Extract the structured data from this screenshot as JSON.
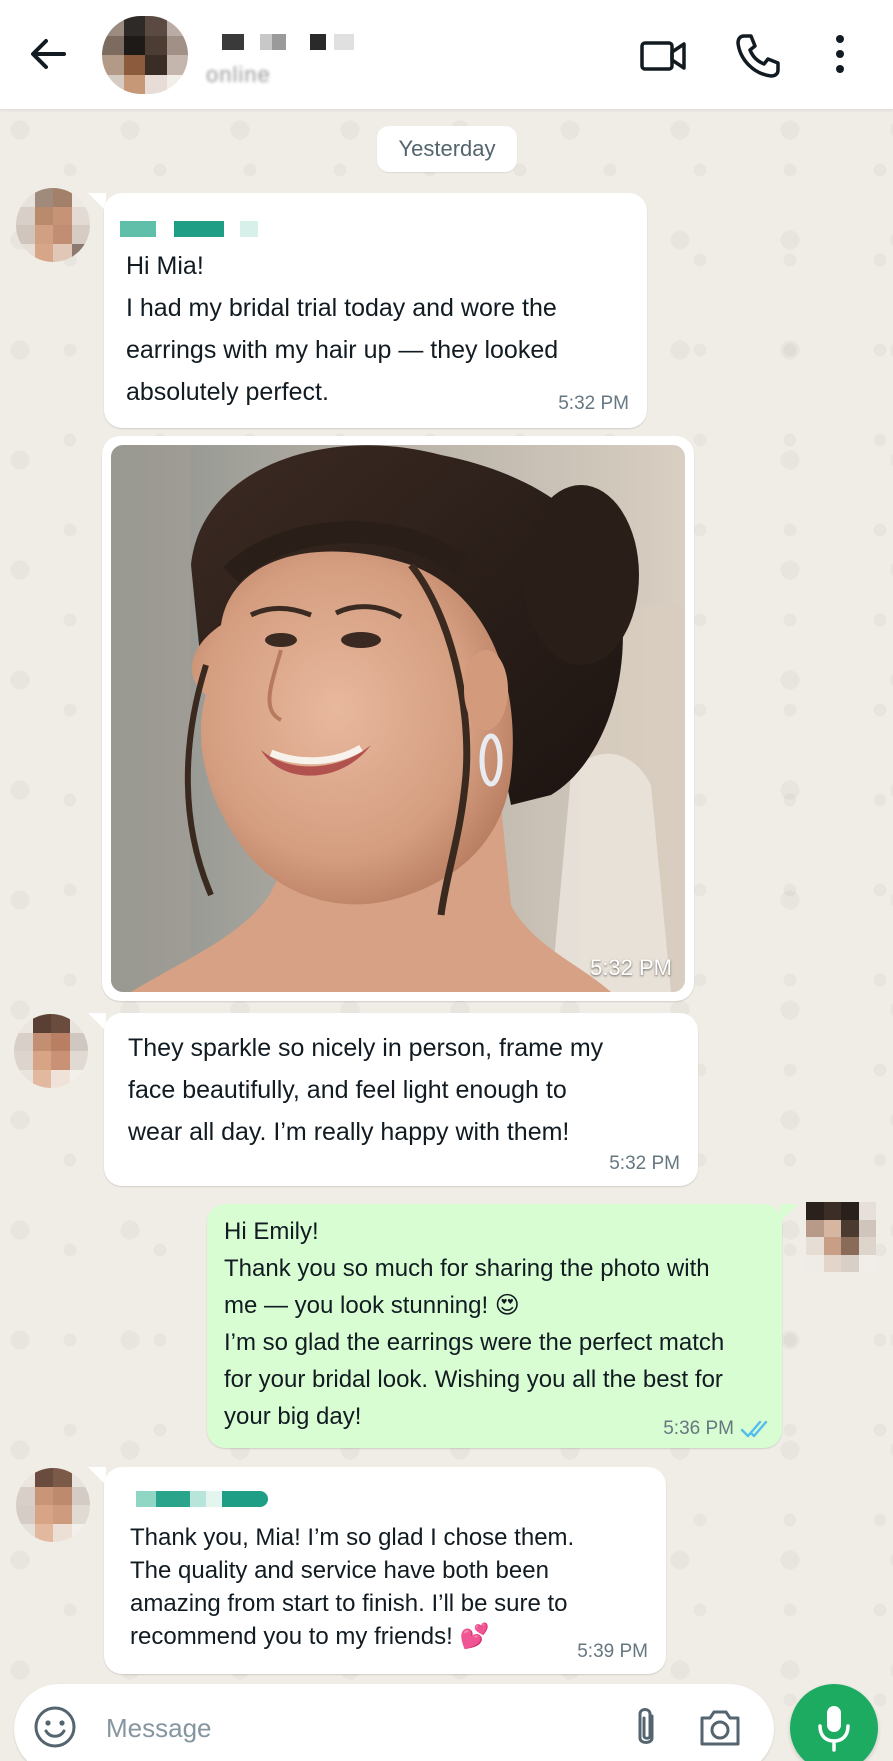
{
  "header": {
    "status": "online"
  },
  "date_chip": "Yesterday",
  "messages": [
    {
      "direction": "in",
      "lines": [
        "Hi Mia!",
        "I had my bridal trial today and wore the",
        "earrings with my hair up — they looked",
        "absolutely perfect."
      ],
      "time": "5:32 PM"
    },
    {
      "direction": "in",
      "type": "image",
      "time": "5:32 PM"
    },
    {
      "direction": "in",
      "lines": [
        "They sparkle so nicely in person, frame my",
        "face beautifully, and feel light enough to",
        "wear all day. I’m really happy with them!"
      ],
      "time": "5:32 PM"
    },
    {
      "direction": "out",
      "lines": [
        "Hi Emily!",
        "Thank you so much for sharing the photo with",
        "me — you look stunning! 😍",
        "I’m so glad the earrings were the perfect match",
        "for your bridal look. Wishing you all the best for",
        "your big day!"
      ],
      "time": "5:36 PM",
      "read_receipt": "double-check-blue"
    },
    {
      "direction": "in",
      "lines": [
        "Thank you, Mia! I’m so glad I chose them.",
        "The quality and service have both been",
        "amazing from start to finish. I’ll be sure to",
        "recommend you to my friends! 💕"
      ],
      "time": "5:39 PM"
    }
  ],
  "composer": {
    "placeholder": "Message"
  },
  "icons": {
    "back": "arrow-left-icon",
    "video": "video-camera-icon",
    "call": "phone-icon",
    "menu": "more-vertical-icon",
    "emoji": "smiley-icon",
    "attach": "paperclip-icon",
    "camera": "camera-icon",
    "mic": "microphone-icon"
  },
  "colors": {
    "incoming_bubble": "#ffffff",
    "outgoing_bubble": "#d9fdd3",
    "accent_green": "#1daa61",
    "read_tick_blue": "#53bdeb",
    "chat_wallpaper": "#efeae2"
  }
}
